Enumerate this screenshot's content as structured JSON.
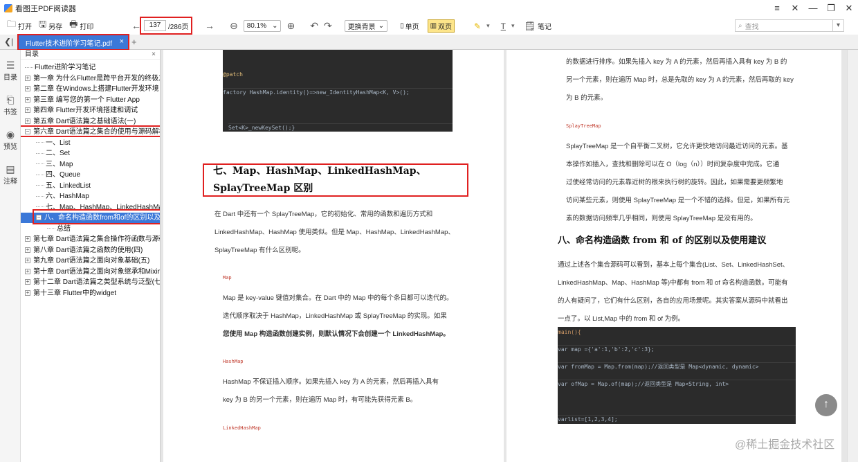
{
  "app": {
    "title": "看图王PDF阅读器"
  },
  "window_controls": {
    "menu": "≡",
    "pin": "✕",
    "min": "—",
    "max": "❐",
    "close": "✕"
  },
  "toolbar": {
    "open": "打开",
    "save_as": "另存",
    "print": "打印",
    "current_page": "137",
    "total_pages": "/286页",
    "zoom": "80.1%",
    "background": "更换背景",
    "single": "单页",
    "double": "双页",
    "notes": "笔记",
    "search_placeholder": "查找"
  },
  "tab": {
    "name": "Flutter技术进阶学习笔记.pdf",
    "close": "×",
    "add": "+"
  },
  "leftbar": {
    "toc": "目录",
    "bookmark": "书签",
    "preview": "预览",
    "annotation": "注释"
  },
  "toc": {
    "title": "目录",
    "items": [
      {
        "text": "Flutter进阶学习笔记",
        "level": 0,
        "exp": ""
      },
      {
        "text": "第一章 为什么Flutter是跨平台开发的终极之选",
        "level": 0,
        "exp": "+"
      },
      {
        "text": "第二章 在Windows上搭建Flutter开发环境",
        "level": 0,
        "exp": "+"
      },
      {
        "text": "第三章 编写您的第一个 Flutter App",
        "level": 0,
        "exp": "+"
      },
      {
        "text": "第四章 Flutter开发环境搭建和调试",
        "level": 0,
        "exp": "+"
      },
      {
        "text": "第五章 Dart语法篇之基础语法(一)",
        "level": 0,
        "exp": "+"
      },
      {
        "text": "第六章 Dart语法篇之集合的使用与源码解析(",
        "level": 0,
        "exp": "−"
      },
      {
        "text": "一、List",
        "level": 1,
        "exp": ""
      },
      {
        "text": "二、Set",
        "level": 1,
        "exp": ""
      },
      {
        "text": "三、Map",
        "level": 1,
        "exp": ""
      },
      {
        "text": "四、Queue",
        "level": 1,
        "exp": ""
      },
      {
        "text": "五、LinkedList",
        "level": 1,
        "exp": ""
      },
      {
        "text": "六、HashMap",
        "level": 1,
        "exp": ""
      },
      {
        "text": "七、Map、HashMap、LinkedHashMap、",
        "level": 1,
        "exp": ""
      },
      {
        "text": "八、命名构造函数from和of的区别以及使",
        "level": 1,
        "exp": "−",
        "selected": true
      },
      {
        "text": "总结",
        "level": 2,
        "exp": ""
      },
      {
        "text": "第七章 Dart语法篇之集合操作符函数与源码分析",
        "level": 0,
        "exp": "+"
      },
      {
        "text": "第八章 Dart语法篇之函数的使用(四)",
        "level": 0,
        "exp": "+"
      },
      {
        "text": "第九章 Dart语法篇之面向对象基础(五)",
        "level": 0,
        "exp": "+"
      },
      {
        "text": "第十章 Dart语法篇之面向对象继承和Mixins",
        "level": 0,
        "exp": "+"
      },
      {
        "text": "第十二章 Dart语法篇之类型系统与泛型(七)",
        "level": 0,
        "exp": "+"
      },
      {
        "text": "第十三章 Flutter中的widget",
        "level": 0,
        "exp": "+"
      }
    ]
  },
  "left_page": {
    "code1": [
      "@patch",
      "factory HashMap.identity()=>new_IdentityHashMap<K, V>();",
      "Set<K>_newKeySet();}"
    ],
    "heading": "七、Map、HashMap、LinkedHashMap、SplayTreeMap 区别",
    "p1": [
      "在 Dart 中还有一个 SplayTreeMap，它的初始化、常用的函数和遍历方式和",
      "LinkedHashMap、HashMap 使用类似。但是 Map、HashMap、LinkedHashMap、",
      "SplayTreeMap 有什么区别呢。"
    ],
    "label_map": "Map",
    "p2": [
      "Map 是 key-value 键值对集合。在 Dart 中的 Map 中的每个条目都可以迭代的。",
      "迭代顺序取决于 HashMap，LinkedHashMap 或 SplayTreeMap 的实现。如果",
      "您使用 Map 构造函数创建实例，则默认情况下会创建一个 LinkedHashMap。"
    ],
    "label_hashmap": "HashMap",
    "p3": [
      "HashMap 不保证插入顺序。如果先插入 key 为 A 的元素，然后再插入具有",
      "key 为 B 的另一个元素，则在遍历 Map 时，有可能先获得元素 B。"
    ],
    "label_linked": "LinkedHashMap"
  },
  "right_page": {
    "p0": [
      "的数据进行排序。如果先插入 key 为 A 的元素，然后再插入具有 key 为 B 的",
      "另一个元素，则在遍历 Map 时，总是先取的 key 为 A 的元素，然后再取的 key",
      "为 B 的元素。"
    ],
    "label_splay": "SplayTreeMap",
    "p1": [
      "SplayTreeMap 是一个自平衡二叉树，它允许更快地访问最近访问的元素。基",
      "本操作如插入，查找和删除可以在 O（log（n））时间复杂度中完成。它通",
      "过使经常访问的元素靠近树的根来执行树的旋转。因此，如果需要更频繁地",
      "访问某些元素，则使用 SplayTreeMap 是一个不错的选择。但是，如果所有元",
      "素的数据访问频率几乎相同，则使用 SplayTreeMap 是没有用的。"
    ],
    "heading": "八、命名构造函数 from 和 of 的区别以及使用建议",
    "p2": [
      "通过上述各个集合源码可以看到，基本上每个集合(List、Set、LinkedHashSet、",
      "LinkedHashMap、Map、HashMap 等)中都有 from 和 of 命名构造函数。可能有",
      "的人有疑问了，它们有什么区别，各自的应用场景呢。其实答案从源码中就看出",
      "一点了。以 List,Map 中的 from 和 of 为例。"
    ],
    "code": [
      "main(){",
      "var map ={'a':1,'b':2,'c':3};",
      "var fromMap = Map.from(map);//返回类型是 Map<dynamic, dynamic>",
      "var ofMap = Map.of(map);//返回类型是 Map<String, int>",
      "varlist=[1,2,3,4];"
    ]
  },
  "scroll_top": "↑",
  "watermark": "@稀土掘金技术社区"
}
